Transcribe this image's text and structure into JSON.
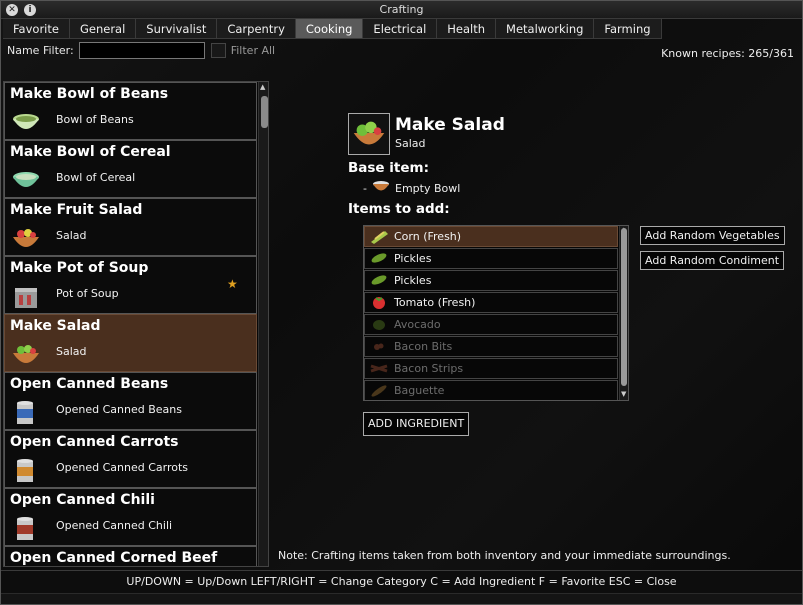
{
  "window": {
    "title": "Crafting"
  },
  "tabs": [
    {
      "label": "Favorite"
    },
    {
      "label": "General"
    },
    {
      "label": "Survivalist"
    },
    {
      "label": "Carpentry"
    },
    {
      "label": "Cooking"
    },
    {
      "label": "Electrical"
    },
    {
      "label": "Health"
    },
    {
      "label": "Metalworking"
    },
    {
      "label": "Farming"
    }
  ],
  "active_tab": "Cooking",
  "filter": {
    "name_label": "Name Filter:",
    "value": "",
    "filter_all_label": "Filter All"
  },
  "known_recipes": {
    "label": "Known recipes:",
    "value": "265/361"
  },
  "recipes": [
    {
      "title": "Make Bowl of Beans",
      "result": "Bowl of Beans",
      "icon": "bowl-of-beans-icon"
    },
    {
      "title": "Make Bowl of Cereal",
      "result": "Bowl of Cereal",
      "icon": "bowl-of-cereal-icon"
    },
    {
      "title": "Make Fruit Salad",
      "result": "Salad",
      "icon": "salad-icon"
    },
    {
      "title": "Make Pot of Soup",
      "result": "Pot of Soup",
      "icon": "pot-icon",
      "favorite": "★"
    },
    {
      "title": "Make Salad",
      "result": "Salad",
      "icon": "salad-icon",
      "selected": true
    },
    {
      "title": "Open Canned Beans",
      "result": "Opened Canned Beans",
      "icon": "can-icon"
    },
    {
      "title": "Open Canned Carrots",
      "result": "Opened Canned Carrots",
      "icon": "can-icon"
    },
    {
      "title": "Open Canned Chili",
      "result": "Opened Canned Chili",
      "icon": "can-icon"
    },
    {
      "title": "Open Canned Corned Beef",
      "result": "",
      "icon": "can-icon"
    }
  ],
  "detail": {
    "title": "Make Salad",
    "subtitle": "Salad",
    "base_label": "Base item:",
    "base_dash": "-",
    "base_item": "Empty Bowl",
    "add_label": "Items to add:"
  },
  "ingredients": [
    {
      "label": "Corn (Fresh)",
      "icon": "corn-icon",
      "selected": true
    },
    {
      "label": "Pickles",
      "icon": "pickle-icon"
    },
    {
      "label": "Pickles",
      "icon": "pickle-icon"
    },
    {
      "label": "Tomato (Fresh)",
      "icon": "tomato-icon"
    },
    {
      "label": "Avocado",
      "icon": "avocado-icon",
      "dim": true
    },
    {
      "label": "Bacon Bits",
      "icon": "bacon-bits-icon",
      "dim": true
    },
    {
      "label": "Bacon Strips",
      "icon": "bacon-strips-icon",
      "dim": true
    },
    {
      "label": "Baguette",
      "icon": "baguette-icon",
      "dim": true
    }
  ],
  "buttons": {
    "add_ingredient": "ADD INGREDIENT",
    "add_random_vegetables": "Add Random Vegetables",
    "add_random_condiment": "Add Random Condiment"
  },
  "note": "Note: Crafting items taken from both inventory and your immediate surroundings.",
  "footer": "UP/DOWN = Up/Down   LEFT/RIGHT = Change Category   C = Add Ingredient   F = Favorite   ESC = Close",
  "colors": {
    "selected": "#4a2f1e",
    "active_tab": "#5a5a5a",
    "star": "#e0a020"
  }
}
